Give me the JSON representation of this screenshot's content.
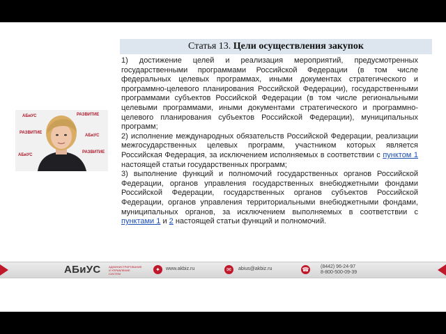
{
  "article": {
    "title_prefix": "Статья 13.",
    "title_bold": "Цели осуществления закупок",
    "p1": "1) достижение целей и реализация мероприятий, предусмотренных государственными программами Российской Федерации (в том числе федеральных целевых программах, иными документах стратегического и программно-целевого планирования Российской Федерации), государственными программами субъектов Российской Федерации (в том числе региональными целевыми программами, иными документами стратегического и программно-целевого планирования субъектов Российской Федерации), муниципальных программ;",
    "p2_before": "2) исполнение международных обязательств Российской Федерации, реализации межгосударственных целевых программ, участником которых является Российская Федерация, за исключением исполняемых в соответствии с ",
    "p2_link": "пунктом 1",
    "p2_after": " настоящей статьи государственных программ;",
    "p3_before": "3) выполнение функций и полномочий государственных органов Российской Федерации, органов управления государственных внебюджетными фондами Российской Федерации, государственных органов субъектов Российской Федерации, органов управления территориальными внебюджетными фондами, муниципальных органов, за исключением выполняемых в соответствии с ",
    "p3_link1": "пунктами 1",
    "p3_mid": " и ",
    "p3_link2": "2",
    "p3_after": " настоящей статьи функций и полномочий."
  },
  "speaker": {
    "watermarks": [
      "АБиУС",
      "РАЗВИТИЕ",
      "РАЗВИТИЕ",
      "АБиУС",
      "РАЗВИТИЕ",
      "АБиУС"
    ]
  },
  "footer": {
    "logo_main": "АБиУС",
    "logo_sub": "АДМИНИСТРИРОВАНИЕ И УПРАВЛЕНИЕ СИСТЕМ",
    "website": "www.akbiz.ru",
    "email": "abius@akbiz.ru",
    "phone1": "(8442) 96-24-97",
    "phone2": "8-800-500-09-39",
    "icons": [
      "globe-icon",
      "mail-icon",
      "phone-icon"
    ]
  },
  "colors": {
    "accent": "#c0172a",
    "title_bg": "#dde6ef",
    "link": "#1a4fb4"
  }
}
